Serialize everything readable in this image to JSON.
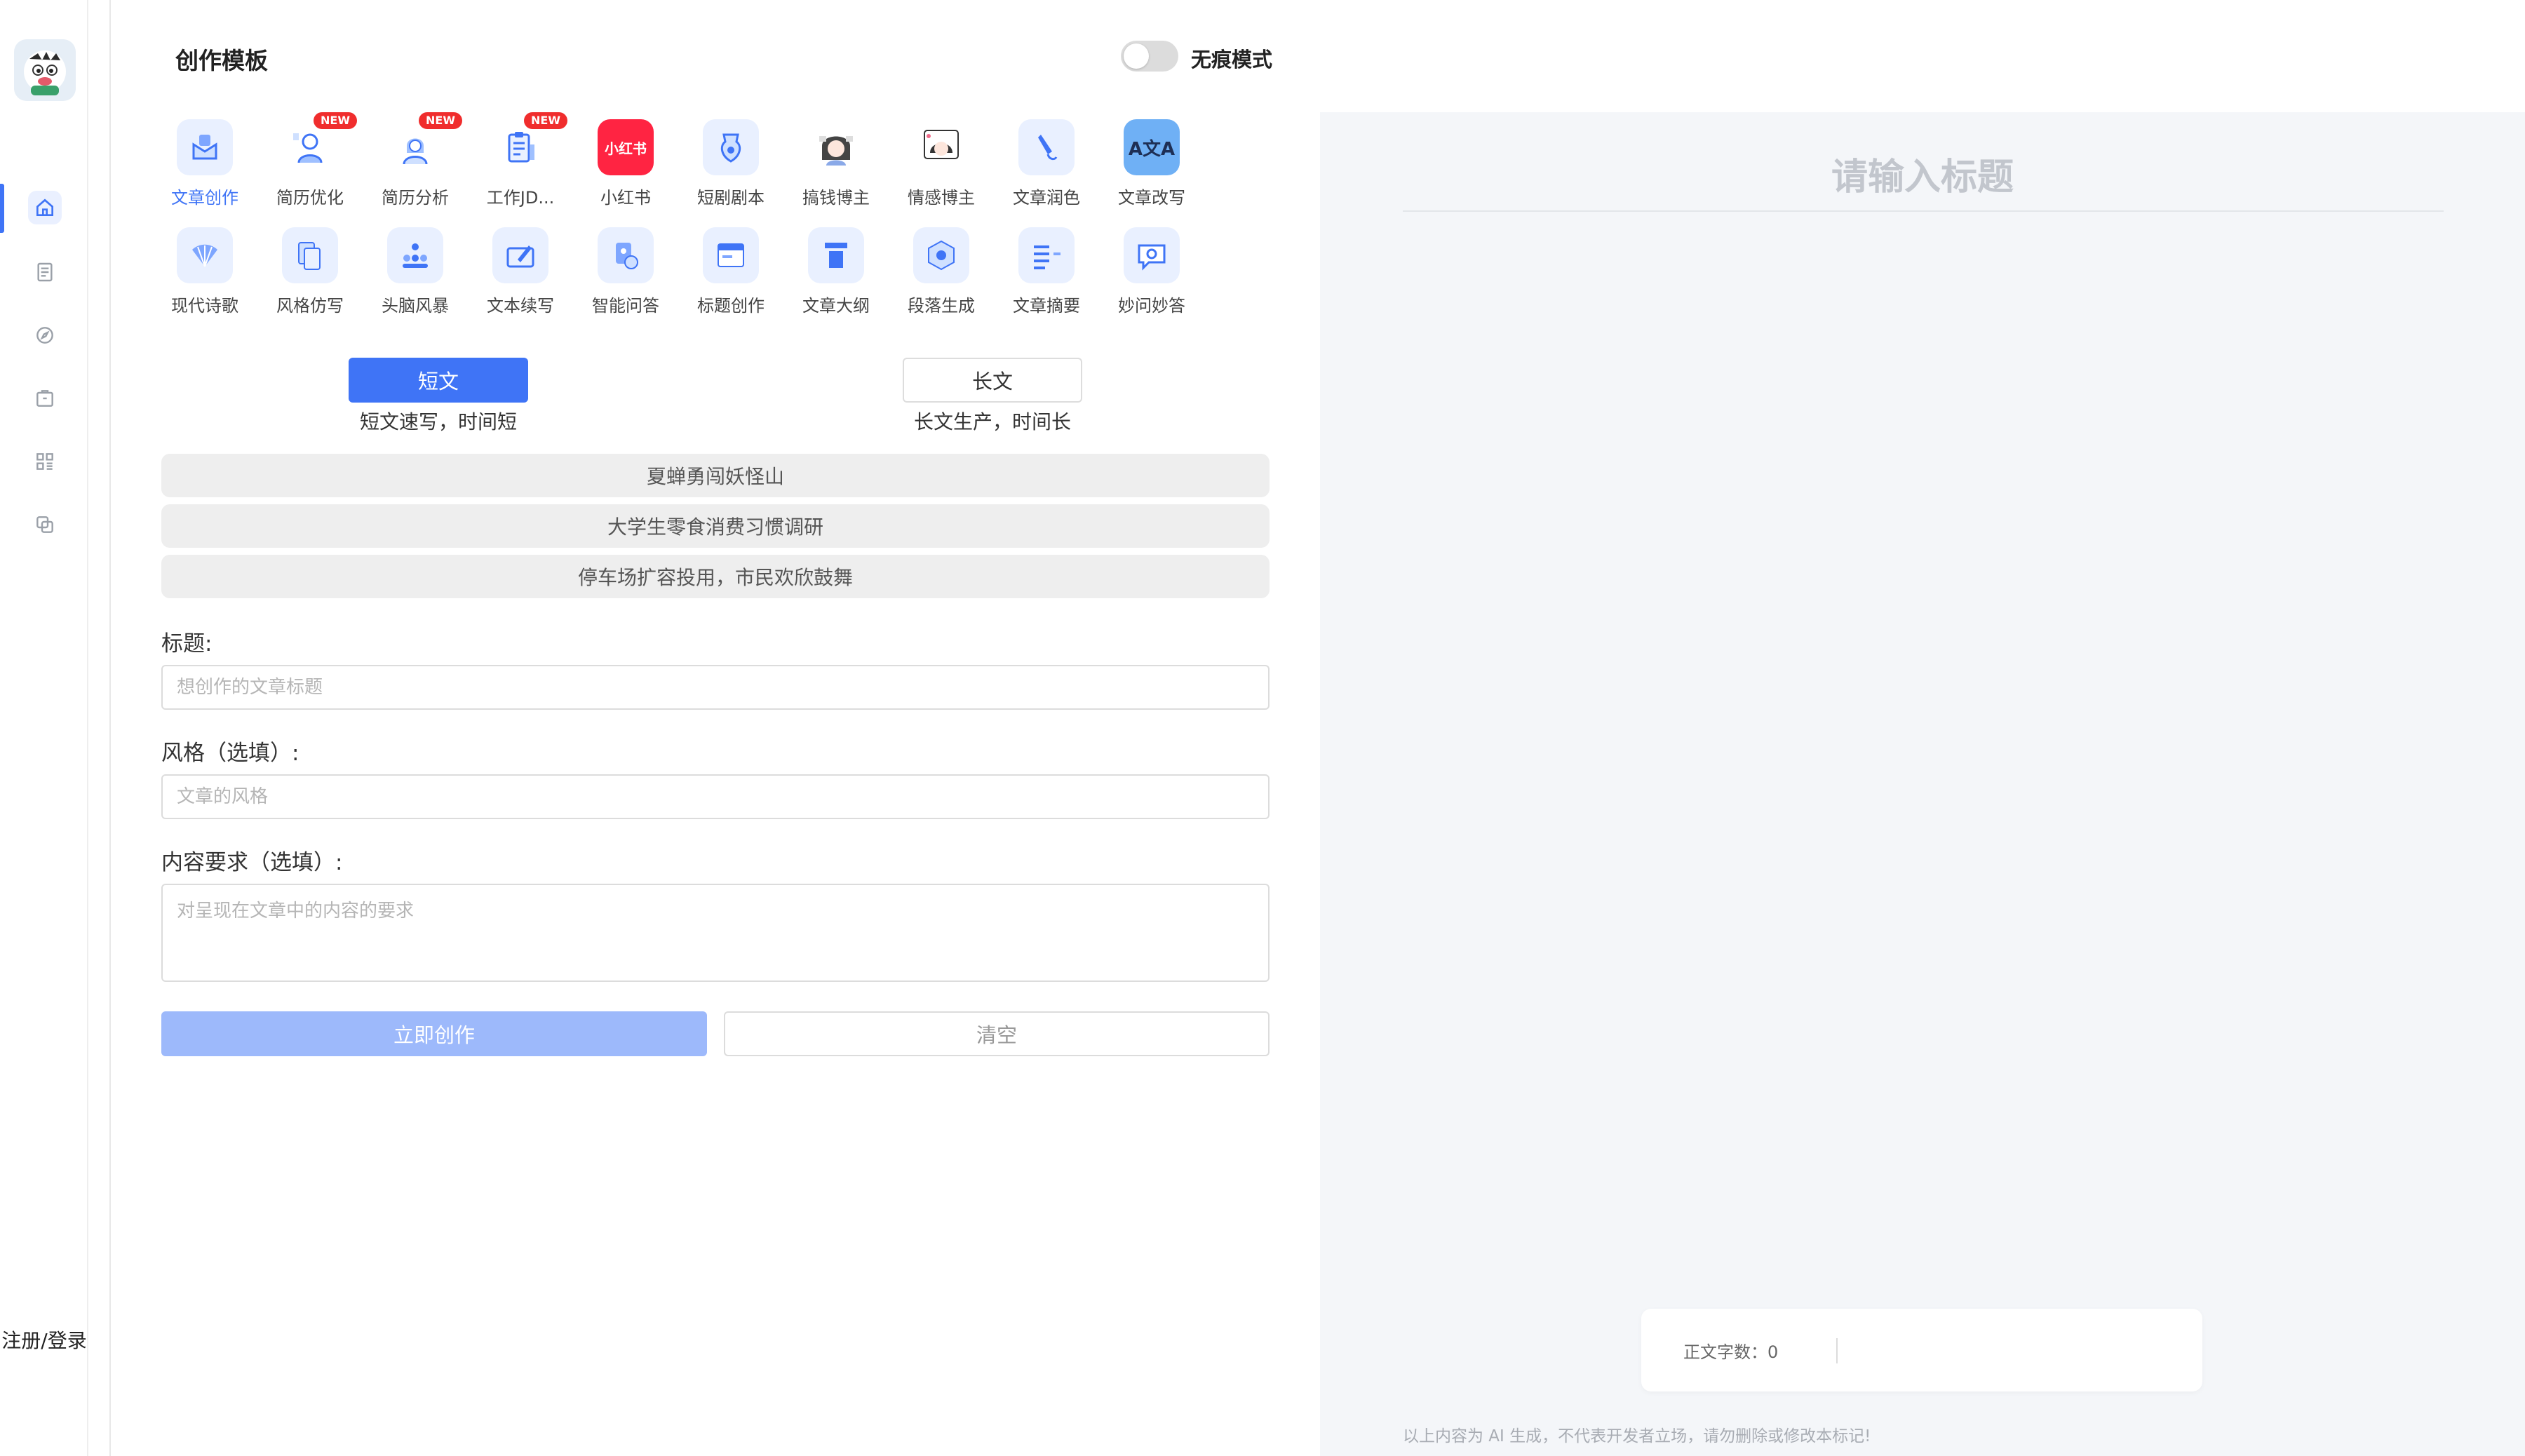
{
  "nav": {
    "items": [
      {
        "name": "home",
        "icon": "home-icon",
        "active": true
      },
      {
        "name": "docs",
        "icon": "document-icon",
        "active": false
      },
      {
        "name": "discover",
        "icon": "compass-icon",
        "active": false
      },
      {
        "name": "bag",
        "icon": "briefcase-icon",
        "active": false
      },
      {
        "name": "apps",
        "icon": "grid-icon",
        "active": false
      },
      {
        "name": "copy",
        "icon": "copy-icon",
        "active": false
      }
    ],
    "login": "注册/登录"
  },
  "panel": {
    "title": "创作模板",
    "incognito_label": "无痕模式",
    "templates": [
      {
        "label": "文章创作",
        "active": true,
        "badge": ""
      },
      {
        "label": "简历优化",
        "active": false,
        "badge": "NEW"
      },
      {
        "label": "简历分析",
        "active": false,
        "badge": "NEW"
      },
      {
        "label": "工作JD...",
        "active": false,
        "badge": "NEW"
      },
      {
        "label": "小红书",
        "active": false,
        "badge": ""
      },
      {
        "label": "短剧剧本",
        "active": false,
        "badge": ""
      },
      {
        "label": "搞钱博主",
        "active": false,
        "badge": ""
      },
      {
        "label": "情感博主",
        "active": false,
        "badge": ""
      },
      {
        "label": "文章润色",
        "active": false,
        "badge": ""
      },
      {
        "label": "文章改写",
        "active": false,
        "badge": ""
      },
      {
        "label": "现代诗歌",
        "active": false,
        "badge": ""
      },
      {
        "label": "风格仿写",
        "active": false,
        "badge": ""
      },
      {
        "label": "头脑风暴",
        "active": false,
        "badge": ""
      },
      {
        "label": "文本续写",
        "active": false,
        "badge": ""
      },
      {
        "label": "智能问答",
        "active": false,
        "badge": ""
      },
      {
        "label": "标题创作",
        "active": false,
        "badge": ""
      },
      {
        "label": "文章大纲",
        "active": false,
        "badge": ""
      },
      {
        "label": "段落生成",
        "active": false,
        "badge": ""
      },
      {
        "label": "文章摘要",
        "active": false,
        "badge": ""
      },
      {
        "label": "妙问妙答",
        "active": false,
        "badge": ""
      }
    ],
    "xiaohongshu_mark": "小红书",
    "rewrite_mark": "A文A",
    "modes": {
      "short_label": "短文",
      "short_desc": "短文速写，时间短",
      "long_label": "长文",
      "long_desc": "长文生产，时间长"
    },
    "suggestions": [
      "夏蝉勇闯妖怪山",
      "大学生零食消费习惯调研",
      "停车场扩容投用，市民欢欣鼓舞"
    ],
    "fields": {
      "title_label": "标题:",
      "title_placeholder": "想创作的文章标题",
      "style_label": "风格（选填）:",
      "style_placeholder": "文章的风格",
      "content_label": "内容要求（选填）:",
      "content_placeholder": "对呈现在文章中的内容的要求"
    },
    "actions": {
      "submit": "立即创作",
      "clear": "清空"
    }
  },
  "preview": {
    "title_placeholder": "请输入标题",
    "word_count": "正文字数：0",
    "disclaimer": "以上内容为 AI 生成，不代表开发者立场，请勿删除或修改本标记!"
  },
  "colors": {
    "accent": "#3f74f6",
    "accent_light": "#9db9fb",
    "badge": "#f02d2d",
    "preview_bg": "#f4f6f9"
  }
}
